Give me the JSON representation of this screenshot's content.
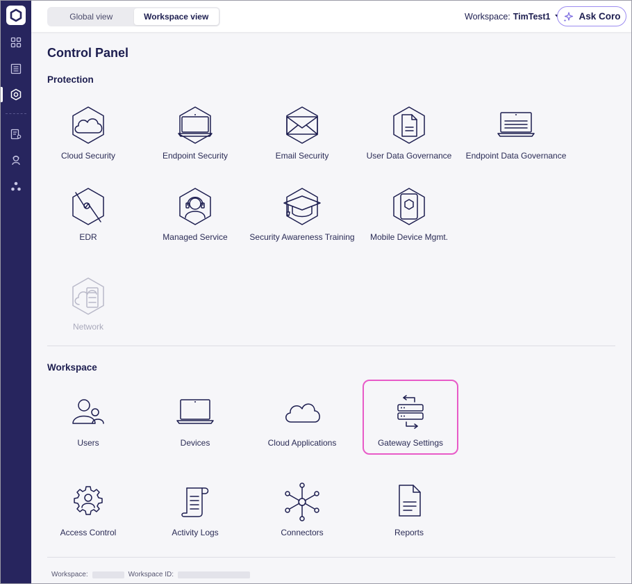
{
  "topbar": {
    "views": [
      "Global view",
      "Workspace view"
    ],
    "active_view": "Workspace view",
    "workspace_label": "Workspace:",
    "workspace_name": "TimTest1",
    "ask_label": "Ask Coro"
  },
  "sidebar": {
    "items": [
      {
        "icon": "dashboard-grid-icon"
      },
      {
        "icon": "list-icon"
      },
      {
        "icon": "control-panel-hexagon-icon",
        "active": true
      },
      {
        "icon": "settings-document-icon"
      },
      {
        "icon": "support-agent-icon"
      },
      {
        "icon": "connections-icon"
      }
    ]
  },
  "page": {
    "title": "Control Panel"
  },
  "protection": {
    "title": "Protection",
    "tiles": [
      {
        "label": "Cloud Security",
        "icon": "cloud-hexagon-icon"
      },
      {
        "label": "Endpoint Security",
        "icon": "laptop-hexagon-icon"
      },
      {
        "label": "Email Security",
        "icon": "envelope-hexagon-icon"
      },
      {
        "label": "User Data Governance",
        "icon": "document-hexagon-icon"
      },
      {
        "label": "Endpoint Data Governance",
        "icon": "laptop-document-icon"
      },
      {
        "label": "EDR",
        "icon": "edr-hexagon-icon"
      },
      {
        "label": "Managed Service",
        "icon": "headset-hexagon-icon"
      },
      {
        "label": "Security Awareness Training",
        "icon": "graduation-cap-icon"
      },
      {
        "label": "Mobile Device Mgmt.",
        "icon": "mobile-hexagon-icon"
      },
      {
        "label": "Network",
        "icon": "network-hexagon-icon",
        "disabled": true
      }
    ]
  },
  "workspace": {
    "title": "Workspace",
    "tiles": [
      {
        "label": "Users",
        "icon": "users-icon"
      },
      {
        "label": "Devices",
        "icon": "laptop-icon"
      },
      {
        "label": "Cloud Applications",
        "icon": "cloud-icon"
      },
      {
        "label": "Gateway Settings",
        "icon": "gateway-server-icon",
        "highlighted": true
      },
      {
        "label": "Access Control",
        "icon": "gear-user-icon"
      },
      {
        "label": "Activity Logs",
        "icon": "scroll-log-icon"
      },
      {
        "label": "Connectors",
        "icon": "connectors-icon"
      },
      {
        "label": "Reports",
        "icon": "report-document-icon"
      }
    ]
  },
  "footer": {
    "workspace_label": "Workspace:",
    "workspace_id_label": "Workspace ID:"
  },
  "colors": {
    "sidebar": "#27255e",
    "text": "#1c1d4f",
    "highlight": "#e85ac8",
    "ask_border": "#9c8cf0"
  }
}
